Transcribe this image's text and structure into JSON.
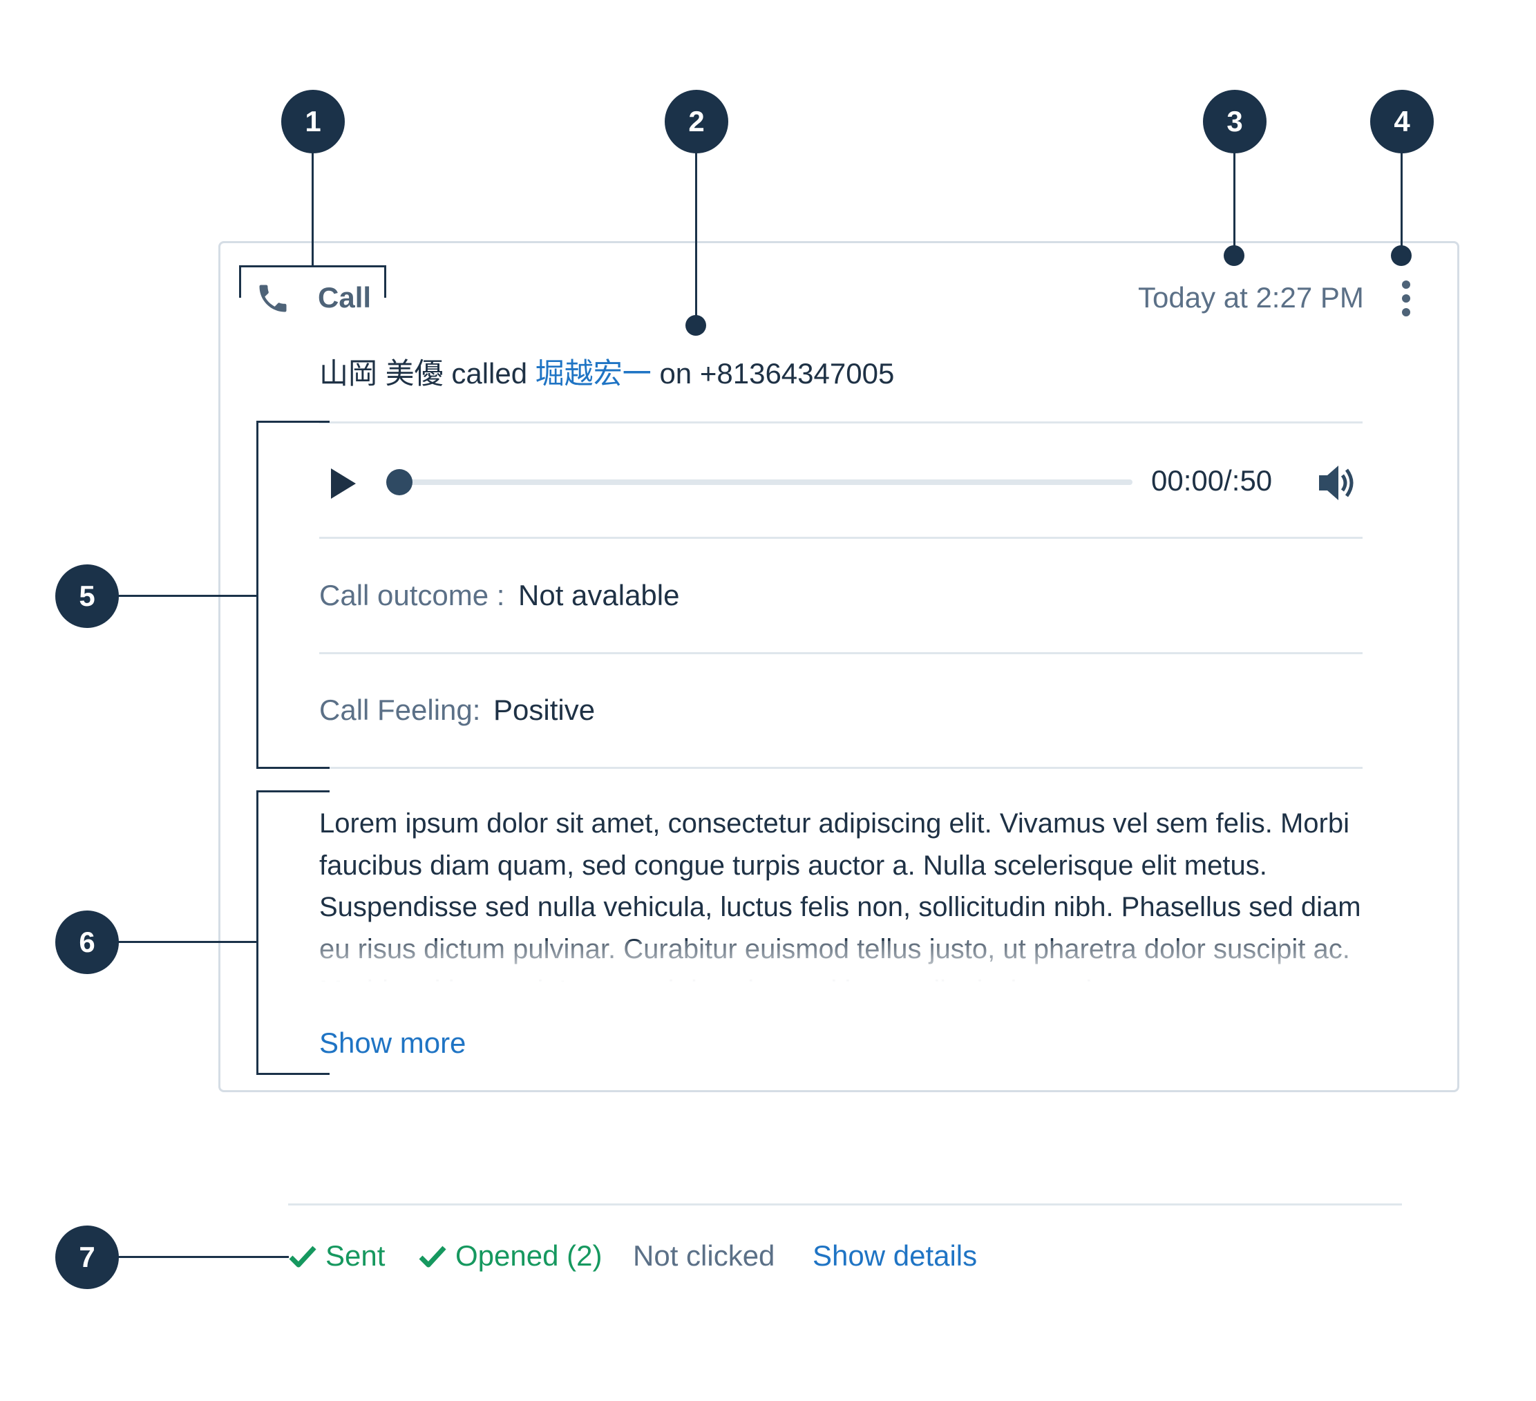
{
  "markers": [
    "1",
    "2",
    "3",
    "4",
    "5",
    "6",
    "7"
  ],
  "card": {
    "type_label": "Call",
    "type_icon": "phone-icon",
    "timestamp": "Today at 2:27 PM",
    "menu_icon": "more-vertical-icon",
    "summary": {
      "caller": "山岡 美優",
      "verb": "called",
      "callee": "堀越宏一",
      "preposition": "on",
      "phone": "+81364347005"
    },
    "player": {
      "play_icon": "play-icon",
      "progress": 0,
      "time": "00:00/:50",
      "volume_icon": "volume-icon"
    },
    "fields": [
      {
        "label": "Call outcome :",
        "value": "Not avalable"
      },
      {
        "label": "Call Feeling:",
        "value": "Positive"
      }
    ],
    "notes": "Lorem ipsum dolor sit amet, consectetur adipiscing elit. Vivamus vel sem felis. Morbi faucibus diam quam, sed congue turpis auctor a. Nulla scelerisque elit metus. Suspendisse sed nulla vehicula, luctus felis non, sollicitudin nibh. Phasellus sed diam eu risus dictum pulvinar. Curabitur euismod tellus justo, ut pharetra dolor suscipit ac. Morbi sed justo mi. Integer ultrices leo sed lectus dignissim, quis",
    "show_more": "Show more"
  },
  "status_bar": {
    "sent": "Sent",
    "opened": "Opened (2)",
    "not_clicked": "Not clicked",
    "show_details": "Show details",
    "success_color": "#16985f",
    "link_color": "#1f74c4"
  }
}
